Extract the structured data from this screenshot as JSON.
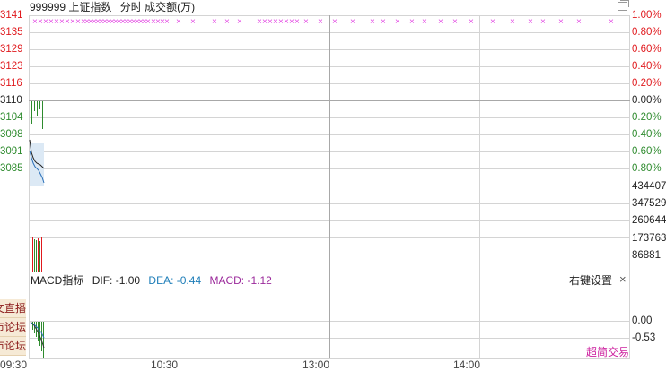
{
  "header": {
    "code": "999999",
    "name": "上证指数",
    "mode": "分时",
    "volume_label": "成交额(万)"
  },
  "price_axis": {
    "left": [
      "3141",
      "3135",
      "3129",
      "3123",
      "3116",
      "3110",
      "3104",
      "3098",
      "3091",
      "3085"
    ],
    "right": [
      "1.00%",
      "0.80%",
      "0.60%",
      "0.40%",
      "0.20%",
      "0.00%",
      "0.20%",
      "0.40%",
      "0.60%",
      "0.80%"
    ]
  },
  "volume_axis": [
    "434407",
    "347529",
    "260644",
    "173763",
    "86881"
  ],
  "macd": {
    "title": "MACD指标",
    "dif_label": "DIF:",
    "dif_value": "-1.00",
    "dea_label": "DEA:",
    "dea_value": "-0.44",
    "macd_label": "MACD:",
    "macd_value": "-1.12",
    "settings_label": "右键设置",
    "close_glyph": "×",
    "axis": [
      "0.00",
      "-0.53"
    ]
  },
  "side_tabs": [
    "图文直播",
    "股市论坛",
    "股市论坛"
  ],
  "time_axis": [
    "09:30",
    "10:30",
    "13:00",
    "14:00"
  ],
  "watermark": "超简交易",
  "marker_glyph": "×",
  "colors": {
    "up": "#e0191d",
    "down": "#2e8b2e",
    "marker": "#e23fe2",
    "grid": "#c8c8c8",
    "brand": "#cc1f9e"
  }
}
